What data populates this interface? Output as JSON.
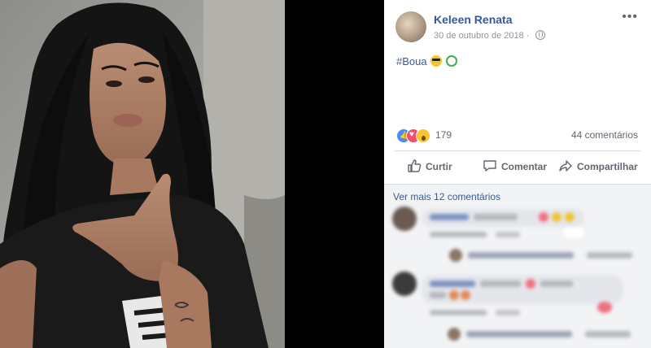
{
  "post": {
    "author": "Keleen Renata",
    "date": "30 de outubro de 2018",
    "date_separator": "·",
    "privacy_icon": "globe-icon",
    "more_icon": "ellipsis-icon",
    "text": "#Boua",
    "emojis": [
      "smiling-face-with-sunglasses",
      "recycle-symbol"
    ]
  },
  "stats": {
    "reaction_types": [
      "like",
      "love",
      "wow"
    ],
    "reaction_count": "179",
    "comments_count": "44 comentários"
  },
  "actions": {
    "like_label": "Curtir",
    "comment_label": "Comentar",
    "share_label": "Compartilhar"
  },
  "comments": {
    "see_more": "Ver mais 12 comentários"
  },
  "colors": {
    "link": "#385898",
    "secondary": "#606770",
    "meta": "#90949c",
    "divider": "#dadde1",
    "comments_bg": "#f2f3f5"
  }
}
